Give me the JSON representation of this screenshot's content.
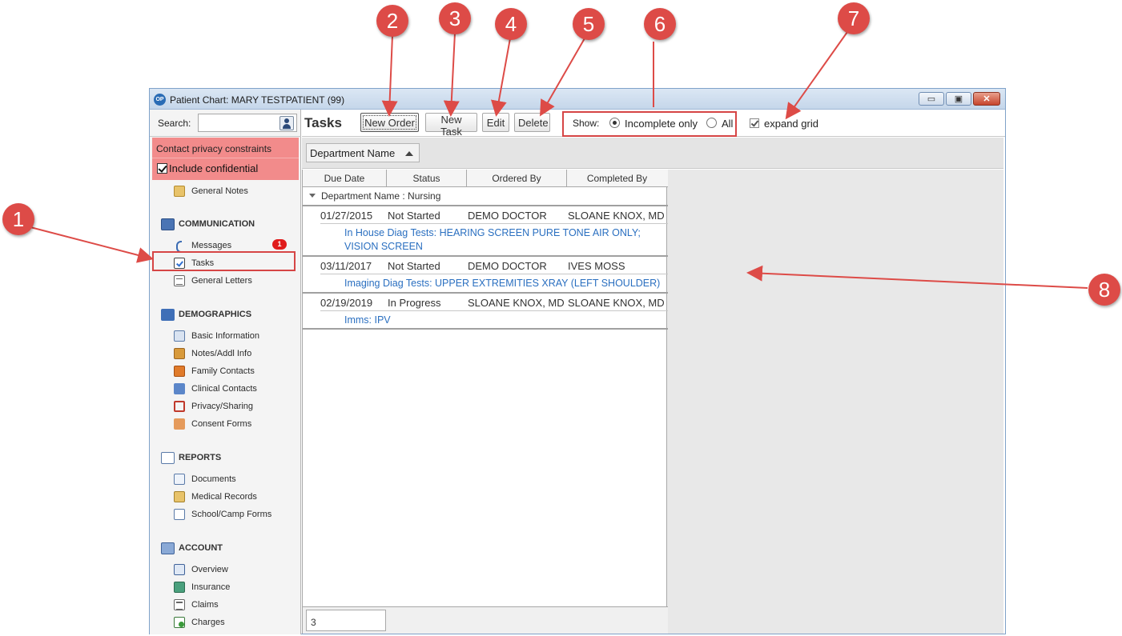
{
  "window": {
    "title": "Patient Chart: MARY TESTPATIENT (99)",
    "logo": "OP",
    "buttons": [
      "minimize-icon",
      "restore-icon",
      "close-icon"
    ],
    "minimize_glyph": "▭",
    "restore_glyph": "▣",
    "close_glyph": "✕"
  },
  "sidebar": {
    "search_label": "Search:",
    "search_value": "",
    "privacy_text": "Contact privacy constraints",
    "include_confidential_label": "Include confidential",
    "include_confidential_checked": true,
    "general_notes": "General Notes",
    "communication": {
      "header": "COMMUNICATION",
      "messages": "Messages",
      "messages_badge": "1",
      "tasks": "Tasks",
      "general_letters": "General Letters"
    },
    "demographics": {
      "header": "DEMOGRAPHICS",
      "items": [
        "Basic Information",
        "Notes/Addl Info",
        "Family Contacts",
        "Clinical Contacts",
        "Privacy/Sharing",
        "Consent Forms"
      ]
    },
    "reports": {
      "header": "REPORTS",
      "items": [
        "Documents",
        "Medical Records",
        "School/Camp Forms"
      ]
    },
    "account": {
      "header": "ACCOUNT",
      "items": [
        "Overview",
        "Insurance",
        "Claims",
        "Charges"
      ]
    }
  },
  "toolbar": {
    "title": "Tasks",
    "new_order": "New Order",
    "new_task": "New Task",
    "edit": "Edit",
    "delete": "Delete",
    "show_label": "Show:",
    "incomplete_only": "Incomplete only",
    "all": "All",
    "selected_filter": "Incomplete only",
    "expand_grid": "expand grid",
    "expand_grid_checked": true
  },
  "grouping": {
    "chip_label": "Department Name",
    "sort": "ascending"
  },
  "grid": {
    "columns": [
      "Due Date",
      "Status",
      "Ordered By",
      "Completed By"
    ],
    "group_label": "Department Name : Nursing",
    "rows": [
      {
        "due_date": "01/27/2015",
        "status": "Not Started",
        "ordered_by": "DEMO DOCTOR",
        "completed_by": "SLOANE KNOX, MD",
        "description_line1": "In House Diag Tests: HEARING SCREEN PURE TONE AIR ONLY;",
        "description_line2": "VISION SCREEN"
      },
      {
        "due_date": "03/11/2017",
        "status": "Not Started",
        "ordered_by": "DEMO DOCTOR",
        "completed_by": "IVES MOSS",
        "description_line1": "Imaging Diag Tests: UPPER EXTREMITIES XRAY (LEFT SHOULDER)",
        "description_line2": ""
      },
      {
        "due_date": "02/19/2019",
        "status": "In Progress",
        "ordered_by": "SLOANE KNOX, MD",
        "completed_by": "SLOANE KNOX, MD",
        "description_line1": "Imms: IPV",
        "description_line2": ""
      }
    ],
    "count": "3"
  },
  "callouts": [
    "1",
    "2",
    "3",
    "4",
    "5",
    "6",
    "7",
    "8"
  ],
  "colors": {
    "callout": "#dd4b47",
    "privacy_block": "#f28b8b",
    "description_link": "#2a6fc0",
    "badge": "#e01b1b"
  }
}
